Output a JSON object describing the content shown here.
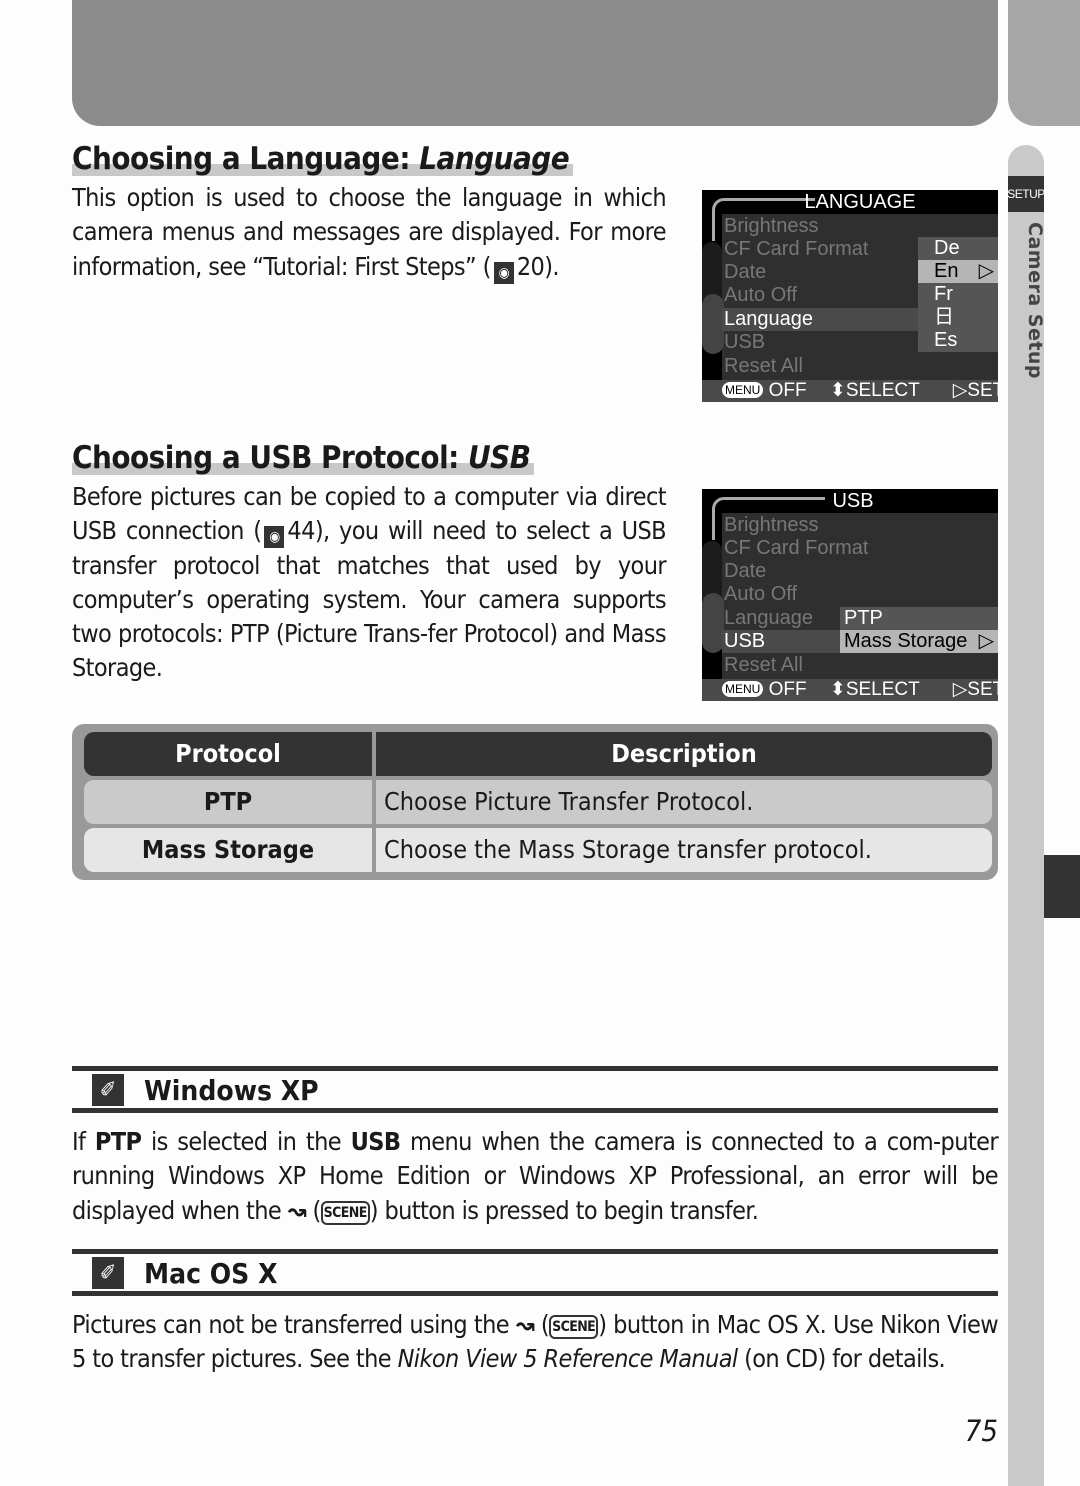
{
  "side": {
    "setup_badge": "SETUP",
    "section_label": "Camera Setup"
  },
  "section1": {
    "title": "Choosing a Language: ",
    "title_italic": "Language",
    "body_before": "This option is used to choose the language in which camera menus and messages are displayed.  For more information, see “Tutorial: First Steps” (",
    "ref_icon": "reference-icon",
    "ref_page": "20",
    "body_after": ")."
  },
  "screen_language": {
    "title": "LANGUAGE",
    "items": [
      "Brightness",
      "CF Card Format",
      "Date",
      "Auto Off",
      "Language",
      "USB",
      "Reset All"
    ],
    "selected_item": "Language",
    "options": [
      "De",
      "En",
      "Fr",
      "日",
      "Es"
    ],
    "selected_option": "En",
    "footer": {
      "menu_badge": "MENU",
      "off": "OFF",
      "select": "⬍SELECT",
      "set": "▷SET"
    }
  },
  "section2": {
    "title": "Choosing a USB Protocol: ",
    "title_italic": "USB",
    "body_p1": "Before pictures can be copied to a computer via direct USB connection (",
    "ref_page": "44",
    "body_p2": "), you will need to select a USB transfer protocol that matches that used by your computer’s operating system.  Your camera supports two protocols: PTP (",
    "p_letter": "P",
    "body_p3": "icture ",
    "t_letter": "T",
    "body_p4": "rans-fer ",
    "p2_letter": "P",
    "body_p5": "rotocol) and Mass Storage."
  },
  "screen_usb": {
    "title": "USB",
    "items": [
      "Brightness",
      "CF Card Format",
      "Date",
      "Auto Off",
      "Language",
      "USB",
      "Reset All"
    ],
    "selected_item": "USB",
    "options": [
      "PTP",
      "Mass Storage"
    ],
    "selected_option": "Mass Storage",
    "footer": {
      "menu_badge": "MENU",
      "off": "OFF",
      "select": "⬍SELECT",
      "set": "▷SET"
    }
  },
  "table": {
    "headers": [
      "Protocol",
      "Description"
    ],
    "rows": [
      {
        "protocol": "PTP",
        "description": "Choose Picture Transfer Protocol."
      },
      {
        "protocol": "Mass Storage",
        "description": "Choose the Mass Storage transfer protocol."
      }
    ]
  },
  "note_windows": {
    "title": "Windows XP",
    "t1": "If ",
    "b1": "PTP",
    "t2": " is selected in the ",
    "b2": "USB",
    "t3": " menu when the camera is connected to a com-puter running Windows XP Home Edition or Windows XP Professional, an error will be displayed when the ",
    "transfer_icon": "↝",
    "scene_label": "SCENE",
    "t4": ") button is pressed to begin transfer."
  },
  "note_mac": {
    "title": "Mac OS X",
    "t1": "Pictures can not be transferred using the ",
    "transfer_icon": "↝",
    "scene_label": "SCENE",
    "t2": ") button in Mac OS X.  Use Nikon View 5 to transfer pictures.  See the ",
    "italic": "Nikon View 5 Reference Manual",
    "t3": " (on CD) for details."
  },
  "page_number": "75"
}
